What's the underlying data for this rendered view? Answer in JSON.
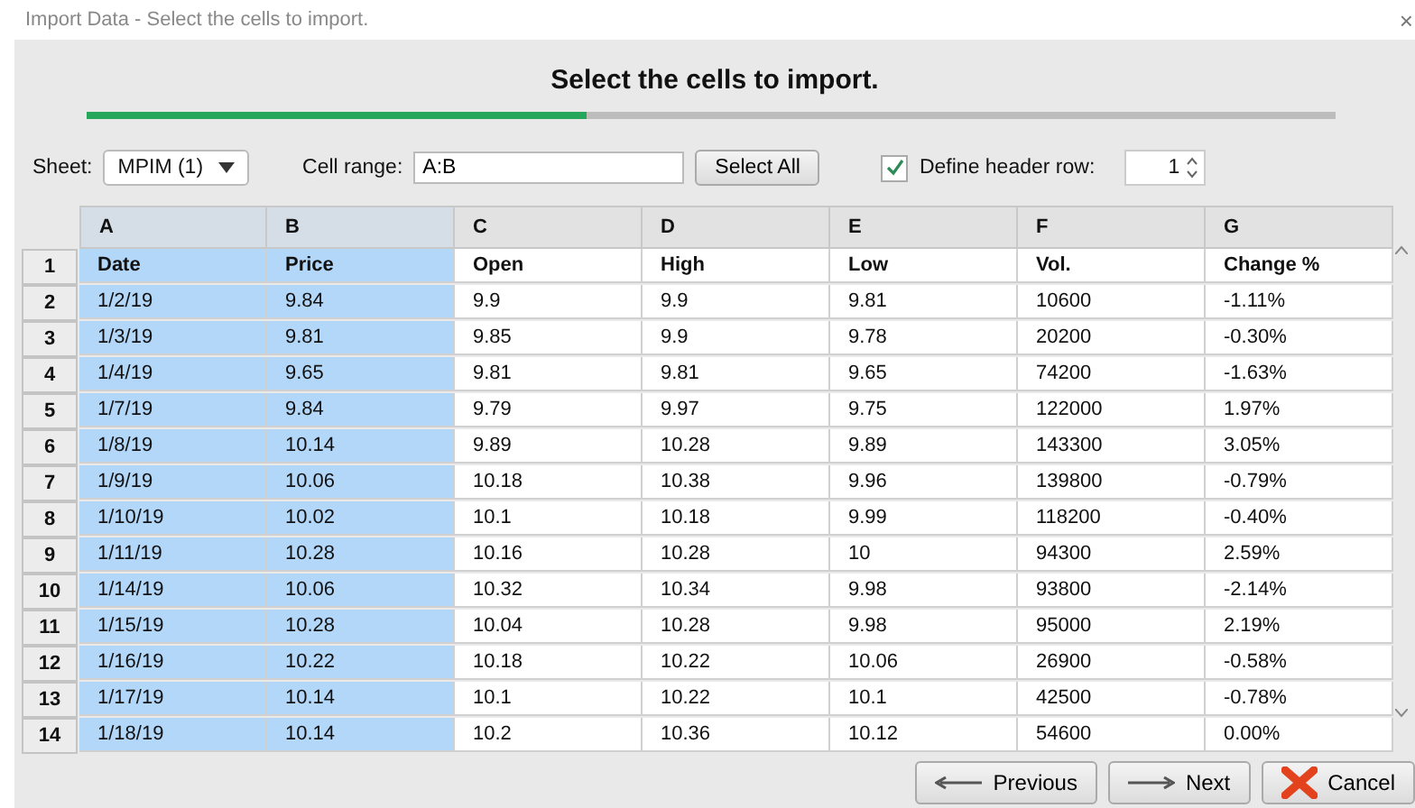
{
  "window": {
    "title": "Import Data - Select the cells to import.",
    "close": "×"
  },
  "heading": "Select the cells to import.",
  "progress": {
    "level": 0.4
  },
  "sheet": {
    "label": "Sheet:",
    "value": "MPIM (1)"
  },
  "cell_range": {
    "label": "Cell range:",
    "value": "A:B"
  },
  "select_all": "Select All",
  "header_row": {
    "label": "Define header row:",
    "checked": true,
    "value": "1"
  },
  "table": {
    "columns": [
      {
        "label": "A",
        "selected": true
      },
      {
        "label": "B",
        "selected": true
      },
      {
        "label": "C",
        "selected": false
      },
      {
        "label": "D",
        "selected": false
      },
      {
        "label": "E",
        "selected": false
      },
      {
        "label": "F",
        "selected": false
      },
      {
        "label": "G",
        "selected": false
      }
    ],
    "rows": [
      {
        "number": "1",
        "cells": [
          "Date",
          "Price",
          "Open",
          "High",
          "Low",
          "Vol.",
          "Change %"
        ]
      },
      {
        "number": "2",
        "cells": [
          "1/2/19",
          "9.84",
          "9.9",
          "9.9",
          "9.81",
          "10600",
          "-1.11%"
        ]
      },
      {
        "number": "3",
        "cells": [
          "1/3/19",
          "9.81",
          "9.85",
          "9.9",
          "9.78",
          "20200",
          "-0.30%"
        ]
      },
      {
        "number": "4",
        "cells": [
          "1/4/19",
          "9.65",
          "9.81",
          "9.81",
          "9.65",
          "74200",
          "-1.63%"
        ]
      },
      {
        "number": "5",
        "cells": [
          "1/7/19",
          "9.84",
          "9.79",
          "9.97",
          "9.75",
          "122000",
          "1.97%"
        ]
      },
      {
        "number": "6",
        "cells": [
          "1/8/19",
          "10.14",
          "9.89",
          "10.28",
          "9.89",
          "143300",
          "3.05%"
        ]
      },
      {
        "number": "7",
        "cells": [
          "1/9/19",
          "10.06",
          "10.18",
          "10.38",
          "9.96",
          "139800",
          "-0.79%"
        ]
      },
      {
        "number": "8",
        "cells": [
          "1/10/19",
          "10.02",
          "10.1",
          "10.18",
          "9.99",
          "118200",
          "-0.40%"
        ]
      },
      {
        "number": "9",
        "cells": [
          "1/11/19",
          "10.28",
          "10.16",
          "10.28",
          "10",
          "94300",
          "2.59%"
        ]
      },
      {
        "number": "10",
        "cells": [
          "1/14/19",
          "10.06",
          "10.32",
          "10.34",
          "9.98",
          "93800",
          "-2.14%"
        ]
      },
      {
        "number": "11",
        "cells": [
          "1/15/19",
          "10.28",
          "10.04",
          "10.28",
          "9.98",
          "95000",
          "2.19%"
        ]
      },
      {
        "number": "12",
        "cells": [
          "1/16/19",
          "10.22",
          "10.18",
          "10.22",
          "10.06",
          "26900",
          "-0.58%"
        ]
      },
      {
        "number": "13",
        "cells": [
          "1/17/19",
          "10.14",
          "10.1",
          "10.22",
          "10.1",
          "42500",
          "-0.78%"
        ]
      },
      {
        "number": "14",
        "cells": [
          "1/18/19",
          "10.14",
          "10.2",
          "10.36",
          "10.12",
          "54600",
          "0.00%"
        ]
      }
    ]
  },
  "buttons": [
    {
      "kind": "previous",
      "label": "Previous"
    },
    {
      "kind": "next",
      "label": "Next"
    },
    {
      "kind": "cancel",
      "label": "Cancel"
    }
  ]
}
